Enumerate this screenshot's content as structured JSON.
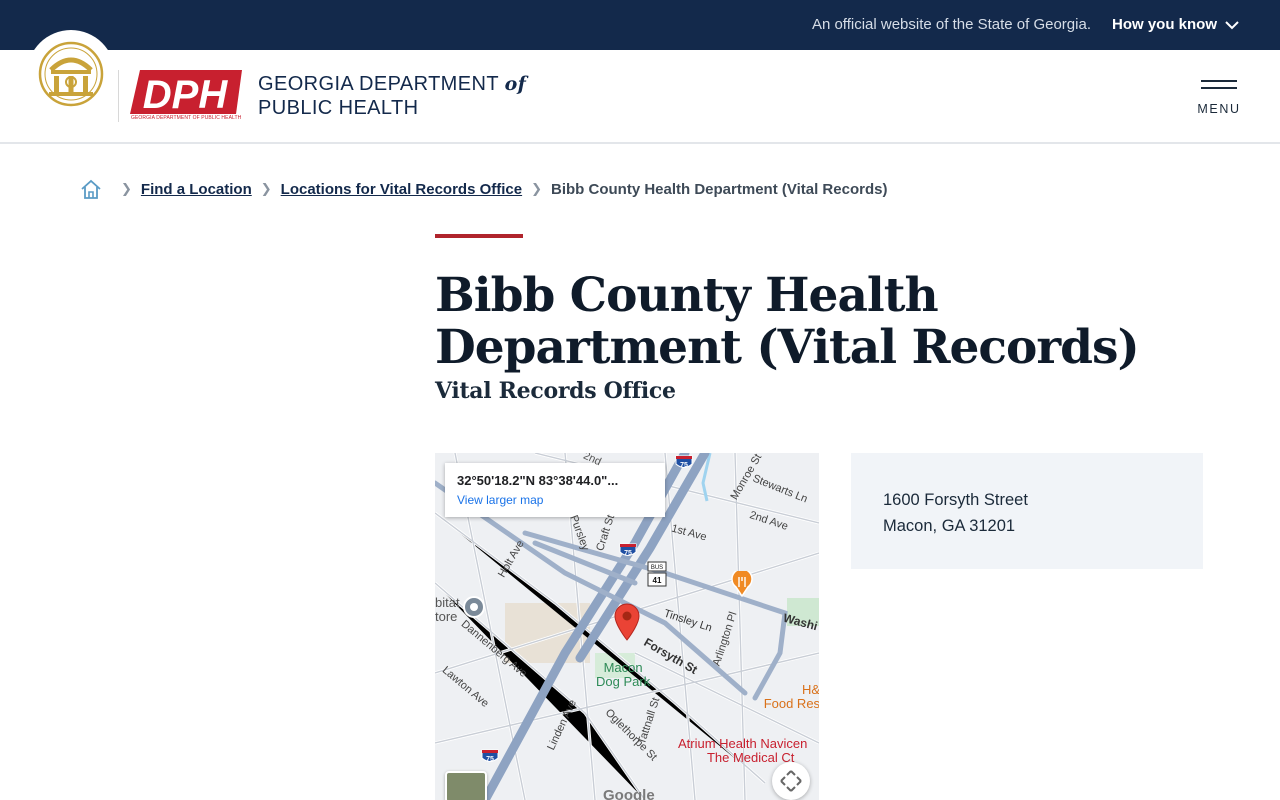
{
  "gov_banner": {
    "official_text": "An official website of the State of Georgia.",
    "how_you_know": "How you know"
  },
  "header": {
    "dph_logo_text": "DPH",
    "dph_logo_subtext": "GEORGIA DEPARTMENT OF PUBLIC HEALTH",
    "dept_name_line1": "GEORGIA DEPARTMENT",
    "dept_name_of": "of",
    "dept_name_line2": "PUBLIC HEALTH",
    "menu_label": "MENU"
  },
  "breadcrumb": {
    "items": [
      {
        "label": "Find a Location"
      },
      {
        "label": "Locations for Vital Records Office"
      }
    ],
    "current": "Bibb County Health Department (Vital Records)"
  },
  "page": {
    "title": "Bibb County Health Department (Vital Records)",
    "subtitle": "Vital Records Office"
  },
  "map": {
    "coords": "32°50'18.2\"N 83°38'44.0\"...",
    "view_larger": "View larger map",
    "streets": [
      "2nd",
      "Monroe St",
      "Stewarts Ln",
      "2nd Ave",
      "1st Ave",
      "Craft St",
      "Pursley",
      "Holt Ave",
      "Dannenberg Ave",
      "Lawton Ave",
      "Tinsley Ln",
      "Forsyth St",
      "Arlington Pl",
      "Washi",
      "Linden Ave",
      "Oglethorpe St",
      "Tattnall St"
    ],
    "places": {
      "dog_park_line1": "Macon",
      "dog_park_line2": "Dog Park",
      "habitat_line1": "bitat",
      "habitat_line2": "tore",
      "food_line1": "H&",
      "food_line2": "Food Res",
      "atrium_line1": "Atrium Health Navicen",
      "atrium_line2": "The Medical Ct"
    },
    "shields": {
      "i75": "75",
      "bus41_top": "BUS",
      "bus41": "41"
    },
    "attribution": "Google"
  },
  "address": {
    "street": "1600 Forsyth Street",
    "city_state_zip": "Macon, GA 31201"
  },
  "colors": {
    "gov_banner_bg": "#13294b",
    "accent_red": "#b0242c",
    "dph_red": "#c8202f",
    "seal_gold": "#c9a33a",
    "address_card_bg": "#f1f4f8"
  }
}
